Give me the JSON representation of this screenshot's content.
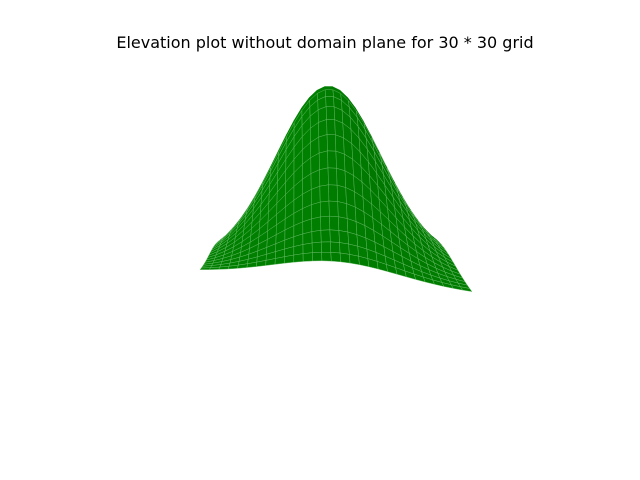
{
  "chart_data": {
    "type": "surface",
    "title": "Elevation plot without domain plane for 30 * 30 grid",
    "grid": {
      "nx": 30,
      "ny": 30
    },
    "surface_shape": "single smooth peak (bell-shaped elevation)",
    "surface_color": "#008000",
    "mesh_line_color": "#6fbf6f",
    "axes_visible": false,
    "domain_plane_visible": false
  }
}
